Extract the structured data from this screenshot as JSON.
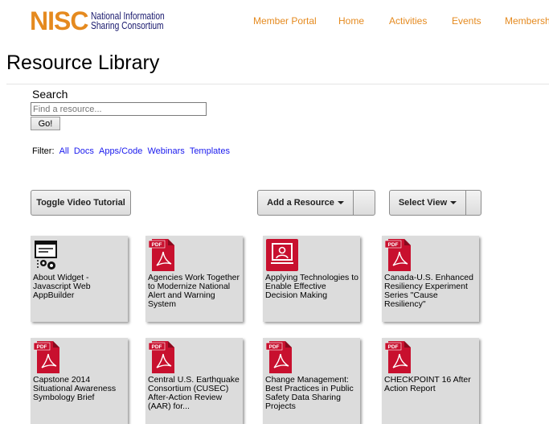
{
  "header": {
    "logo_mark": "NISC",
    "logo_line1": "National Information",
    "logo_line2": "Sharing Consortium",
    "nav": [
      "Member Portal",
      "Home",
      "Activities",
      "Events",
      "Membershi"
    ]
  },
  "page_title": "Resource Library",
  "search": {
    "label": "Search",
    "placeholder": "Find a resource...",
    "button": "Go!"
  },
  "filter": {
    "label": "Filter:",
    "options": [
      "All",
      "Docs",
      "Apps/Code",
      "Webinars",
      "Templates"
    ]
  },
  "toolbar": {
    "toggle_video": "Toggle Video Tutorial",
    "add_resource": "Add a Resource",
    "select_view": "Select View"
  },
  "colors": {
    "brand_orange": "#e58a1f",
    "brand_navy": "#1a1a6e",
    "pdf_red": "#c8102e",
    "link_blue": "#1a1aee",
    "card_bg": "#dcdcdc"
  },
  "resources": [
    {
      "title": "About Widget - Javascript Web AppBuilder",
      "icon": "widget-config-icon"
    },
    {
      "title": "Agencies Work Together to Modernize National Alert and Warning System",
      "icon": "pdf-icon"
    },
    {
      "title": "Applying Technologies to Enable Effective Decision Making",
      "icon": "presentation-icon"
    },
    {
      "title": "Canada-U.S. Enhanced Resiliency Experiment Series \"Cause Resiliency\"",
      "icon": "pdf-icon"
    },
    {
      "title": "Capstone 2014 Situational Awareness Symbology Brief",
      "icon": "pdf-icon"
    },
    {
      "title": "Central U.S. Earthquake Consortium (CUSEC) After-Action Review (AAR) for...",
      "icon": "pdf-icon"
    },
    {
      "title": "Change Management: Best Practices in Public Safety Data Sharing Projects",
      "icon": "pdf-icon"
    },
    {
      "title": "CHECKPOINT 16 After Action Report",
      "icon": "pdf-icon"
    }
  ]
}
